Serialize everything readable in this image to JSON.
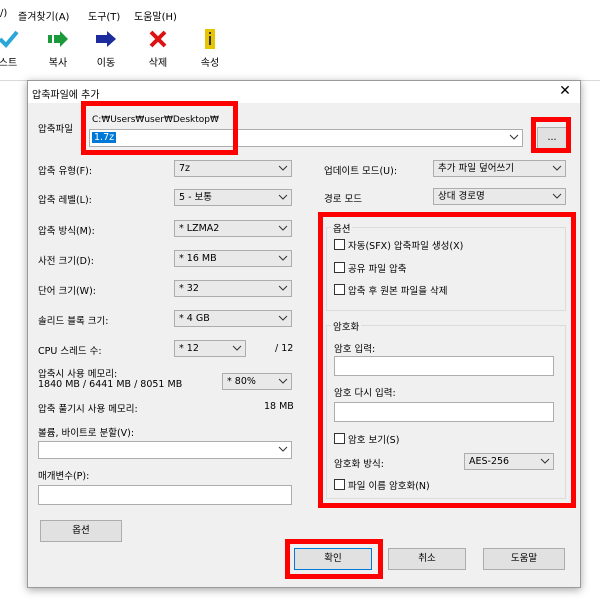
{
  "menu": {
    "items": [
      "/)",
      "즐겨찾기(A)",
      "도구(T)",
      "도움말(H)"
    ]
  },
  "toolbar": {
    "buttons": [
      {
        "label": "스트",
        "icon": "check-icon"
      },
      {
        "label": "복사",
        "icon": "copy-arrow-icon"
      },
      {
        "label": "이동",
        "icon": "move-arrow-icon"
      },
      {
        "label": "삭제",
        "icon": "delete-x-icon"
      },
      {
        "label": "속성",
        "icon": "info-icon"
      }
    ]
  },
  "dialog": {
    "title": "압축파일에 추가",
    "archive_label": "압축파일",
    "archive_path": "C:₩Users₩user₩Desktop₩",
    "archive_name": "1.7z",
    "browse_label": "...",
    "left": {
      "format_label": "압축 유형(F):",
      "format_value": "7z",
      "level_label": "압축 레벨(L):",
      "level_value": "5 - 보통",
      "method_label": "압축 방식(M):",
      "method_value": "* LZMA2",
      "dict_label": "사전 크기(D):",
      "dict_value": "* 16 MB",
      "word_label": "단어 크기(W):",
      "word_value": "* 32",
      "solid_label": "솔리드 블록 크기:",
      "solid_value": "* 4 GB",
      "cpu_label": "CPU 스레드 수:",
      "cpu_value": "* 12",
      "cpu_total": "/ 12",
      "mem_label": "압축시 사용 메모리:",
      "mem_detail": "1840 MB / 6441 MB / 8051 MB",
      "mem_value": "* 80%",
      "decomp_label": "압축 풀기시 사용 메모리:",
      "decomp_value": "18 MB",
      "volume_label": "볼륨, 바이트로 분할(V):",
      "params_label": "매개변수(P):",
      "options_button": "옵션"
    },
    "right": {
      "update_label": "업데이트 모드(U):",
      "update_value": "추가 파일 덮어쓰기",
      "path_label": "경로 모드",
      "path_value": "상대 경로명",
      "options_group": "옵션",
      "sfx_label": "자동(SFX) 압축파일 생성(X)",
      "shared_label": "공유 파일 압축",
      "delete_label": "압축 후 원본 파일을 삭제",
      "enc_group": "암호화",
      "pw_label": "암호 입력:",
      "pw2_label": "암호 다시 입력:",
      "show_pw_label": "암호 보기(S)",
      "enc_method_label": "암호화 방식:",
      "enc_method_value": "AES-256",
      "enc_names_label": "파일 이름 암호화(N)"
    },
    "footer": {
      "ok": "확인",
      "cancel": "취소",
      "help": "도움말"
    }
  },
  "colors": {
    "highlight_red": "#ff0000",
    "selection_blue": "#0078d7",
    "dialog_bg": "#f0f0f0"
  }
}
